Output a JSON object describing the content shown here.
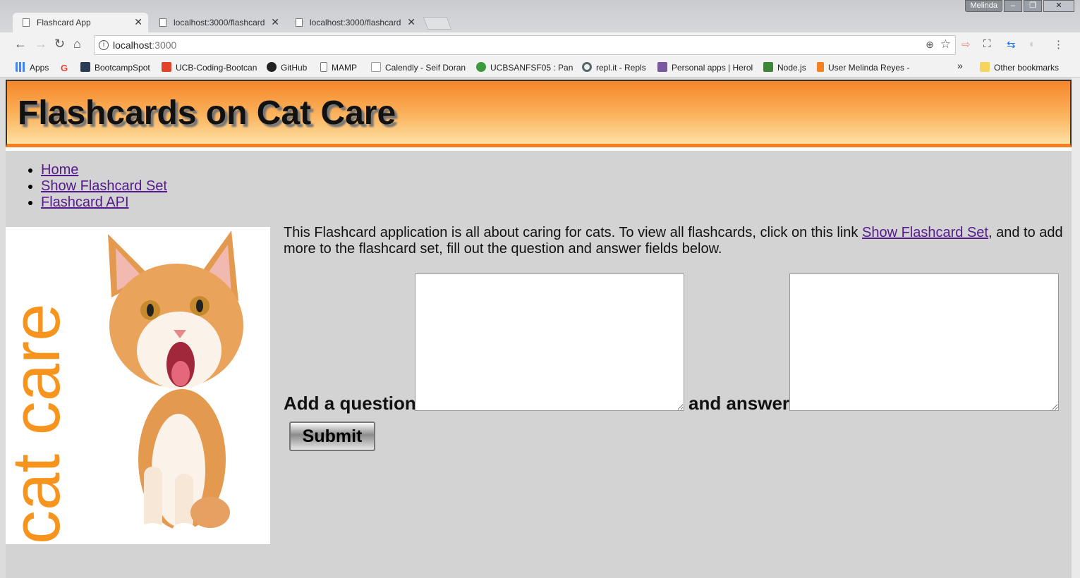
{
  "browser": {
    "tabs": [
      {
        "label": "Flashcard App",
        "active": true
      },
      {
        "label": "localhost:3000/flashcard",
        "active": false
      },
      {
        "label": "localhost:3000/flashcard",
        "active": false
      }
    ],
    "window_user": "Melinda",
    "url_host": "localhost",
    "url_port": ":3000",
    "bookmarks": [
      {
        "label": "Apps",
        "icon": "apps-grid-icon",
        "color": "#4285f4"
      },
      {
        "label": "",
        "icon": "google-icon",
        "color": "#ea4335"
      },
      {
        "label": "BootcampSpot",
        "icon": "bootcampspot-icon",
        "color": "#2b3a55"
      },
      {
        "label": "UCB-Coding-Bootcan",
        "icon": "gitlab-icon",
        "color": "#e24329"
      },
      {
        "label": "GitHub",
        "icon": "github-icon",
        "color": "#222222"
      },
      {
        "label": "MAMP",
        "icon": "page-icon",
        "color": "#ffffff"
      },
      {
        "label": "Calendly - Seif Doran",
        "icon": "calendly-icon",
        "color": "#ffffff"
      },
      {
        "label": "UCBSANFSF05 : Panc",
        "icon": "canvas-icon",
        "color": "#3c9a3c"
      },
      {
        "label": "repl.it - Repls",
        "icon": "replit-icon",
        "color": "#56676e"
      },
      {
        "label": "Personal apps | Herol",
        "icon": "heroku-icon",
        "color": "#79589f"
      },
      {
        "label": "Node.js",
        "icon": "nodejs-icon",
        "color": "#3c873a"
      },
      {
        "label": "User Melinda Reyes -",
        "icon": "stackoverflow-icon",
        "color": "#f48024"
      }
    ],
    "more_bookmarks": "»",
    "other_bookmarks": "Other bookmarks"
  },
  "page": {
    "title": "Flashcards on Cat Care",
    "nav": [
      "Home",
      "Show Flashcard Set",
      "Flashcard API"
    ],
    "image_text": "cat care",
    "intro_before_link": "This Flashcard application is all about caring for cats. To view all flashcards, click on this link ",
    "intro_link": "Show Flashcard Set",
    "intro_after_link": ", and to add more to the flashcard set, fill out the question and answer fields below.",
    "question_label": "Add a question",
    "question_value": "",
    "answer_label": "and answer",
    "answer_value": "",
    "submit_label": "Submit"
  },
  "colors": {
    "header_top": "#f5862a",
    "header_bottom": "#fde1a4",
    "cat_care_text": "#f7941d",
    "page_bg": "#d3d3d3",
    "link": "#551a8b"
  }
}
